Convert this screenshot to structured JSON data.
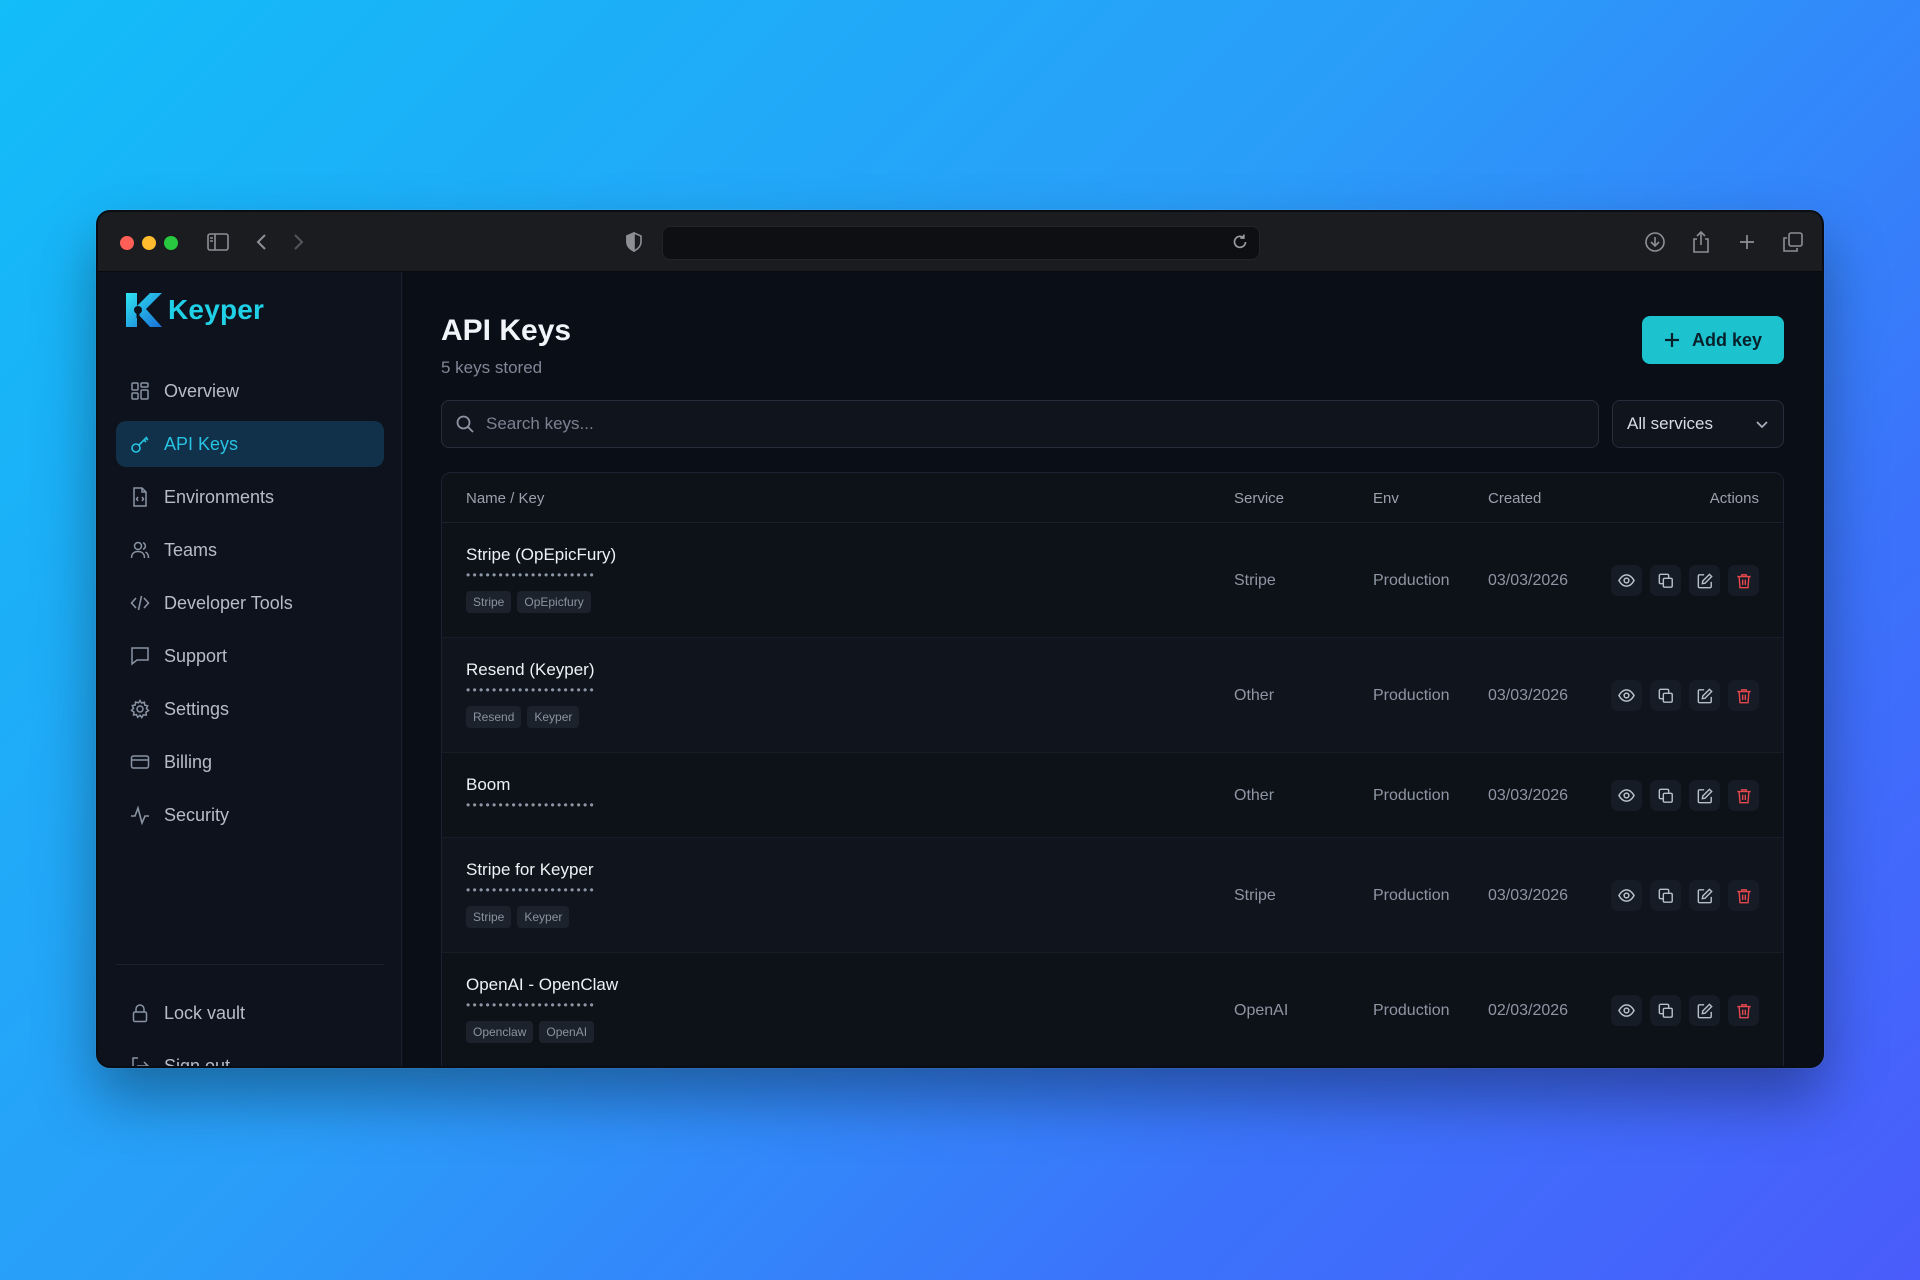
{
  "app": {
    "name": "Keyper"
  },
  "sidebar": {
    "items": [
      {
        "label": "Overview",
        "icon": "grid-icon",
        "active": false
      },
      {
        "label": "API Keys",
        "icon": "key-icon",
        "active": true
      },
      {
        "label": "Environments",
        "icon": "file-code-icon",
        "active": false
      },
      {
        "label": "Teams",
        "icon": "users-icon",
        "active": false
      },
      {
        "label": "Developer Tools",
        "icon": "code-icon",
        "active": false
      },
      {
        "label": "Support",
        "icon": "message-icon",
        "active": false
      },
      {
        "label": "Settings",
        "icon": "gear-icon",
        "active": false
      },
      {
        "label": "Billing",
        "icon": "credit-card-icon",
        "active": false
      },
      {
        "label": "Security",
        "icon": "activity-icon",
        "active": false
      }
    ],
    "bottom": [
      {
        "label": "Lock vault",
        "icon": "lock-icon"
      },
      {
        "label": "Sign out",
        "icon": "sign-out-icon"
      }
    ]
  },
  "header": {
    "title": "API Keys",
    "subtitle": "5 keys stored",
    "add_label": "Add key"
  },
  "search": {
    "placeholder": "Search keys...",
    "value": ""
  },
  "filter": {
    "selected": "All services"
  },
  "table": {
    "columns": [
      "Name / Key",
      "Service",
      "Env",
      "Created",
      "Actions"
    ],
    "mask": "••••••••••••••••••••",
    "rows": [
      {
        "name": "Stripe (OpEpicFury)",
        "tags": [
          "Stripe",
          "OpEpicfury"
        ],
        "service": "Stripe",
        "env": "Production",
        "created": "03/03/2026"
      },
      {
        "name": "Resend (Keyper)",
        "tags": [
          "Resend",
          "Keyper"
        ],
        "service": "Other",
        "env": "Production",
        "created": "03/03/2026"
      },
      {
        "name": "Boom",
        "tags": [],
        "service": "Other",
        "env": "Production",
        "created": "03/03/2026"
      },
      {
        "name": "Stripe for Keyper",
        "tags": [
          "Stripe",
          "Keyper"
        ],
        "service": "Stripe",
        "env": "Production",
        "created": "03/03/2026"
      },
      {
        "name": "OpenAI - OpenClaw",
        "tags": [
          "Openclaw",
          "OpenAI"
        ],
        "service": "OpenAI",
        "env": "Production",
        "created": "02/03/2026"
      }
    ]
  },
  "colors": {
    "accent": "#1cc3cf",
    "danger": "#e5484d",
    "background": "#0a0e16"
  }
}
